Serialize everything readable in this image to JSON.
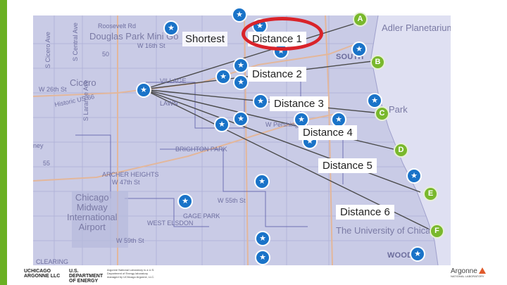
{
  "map": {
    "labels": {
      "roosevelt": "Roosevelt Rd",
      "douglas": "Douglas Park Mini Go",
      "w16th": "W 16th St",
      "cicero": "Cicero",
      "w26th": "W 26th St",
      "historic": "Historic US 66",
      "lawn": "LAWN",
      "village": "VILLAGE",
      "brighton": "BRIGHTON PARK",
      "archer": "ARCHER HEIGHTS",
      "w47th": "W 47th St",
      "chicago_midway": "Chicago\nMidway\nInternational\nAirport",
      "gage": "GAGE PARK",
      "west_elsdon": "WEST ELSDON",
      "w59th": "W 59th St",
      "w55th": "W 55th St",
      "clearing": "CLEARING",
      "woodlawn": "WOODL",
      "adler": "Adler Planetarium",
      "south": "SOUTH",
      "park": "Park",
      "u_chicago": "The University of Chicago",
      "ney": "ney",
      "cicero_ave": "S Cicero Ave",
      "central_ave": "S Central Ave",
      "laramie_ave": "S Laramie Ave",
      "route_50": "50",
      "route_55": "55",
      "pershing": "W Pershing Rd"
    }
  },
  "callouts": {
    "shortest": "Shortest",
    "d1": "Distance 1",
    "d2": "Distance 2",
    "d3": "Distance 3",
    "d4": "Distance 4",
    "d5": "Distance 5",
    "d6": "Distance 6"
  },
  "markers": {
    "a": "A",
    "b": "B",
    "c": "C",
    "d": "D",
    "e": "E",
    "f": "F"
  },
  "colors": {
    "accent_green": "#6ab023",
    "highlight_red": "#d9232a",
    "marker_green": "#79b82c",
    "station_blue": "#1a73c8"
  },
  "footer": {
    "uchicago": "UCHICAGO",
    "argonne_llc": "ARGONNE LLC",
    "doe": "U.S. DEPARTMENT OF ENERGY",
    "doe_small": "Argonne National Laboratory is a U.S. Department of Energy laboratory managed by UChicago Argonne, LLC.",
    "argonne": "Argonne",
    "argonne_sub": "NATIONAL LABORATORY"
  }
}
